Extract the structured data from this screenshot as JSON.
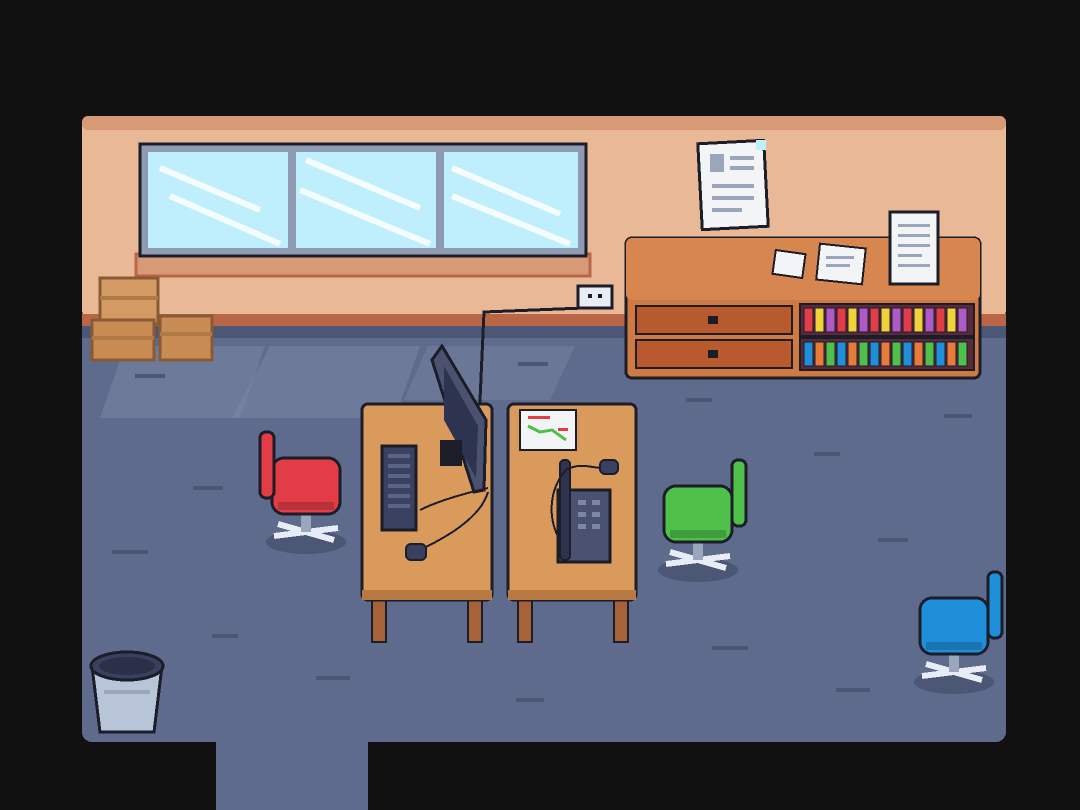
{
  "scene": {
    "type": "top-down pixel-art office room",
    "palette": {
      "background": "#111111",
      "wall": "#e9b896",
      "wall_trim": "#b86646",
      "floor": "#5f6b8c",
      "floor_dark": "#4c5675",
      "sunlight": "#7a87a5",
      "outline": "#1b1d29",
      "desk": "#d99a5c",
      "desk_leg": "#a8623a",
      "cabinet": "#cf7a43",
      "drawer": "#b95a2e",
      "window_glass": "#bfeefc",
      "window_frame": "#8f9bb3",
      "box": "#d39a64",
      "paper": "#f2f4f6",
      "chair_red": "#e23d46",
      "chair_green": "#4fc04a",
      "chair_blue": "#1e8fd8",
      "chair_base": "#e8ecf4",
      "bin": "#b8c4d8",
      "monitor": "#4a5270"
    },
    "icons": {
      "window": "window-icon",
      "notice": "notice-paper-icon",
      "cabinet": "cabinet-icon",
      "books": "book-row-icon",
      "boxes": "cardboard-box-icon",
      "outlet": "power-outlet-icon",
      "monitor": "monitor-icon",
      "keyboard": "keyboard-icon",
      "mouse": "mouse-icon",
      "phone": "desk-phone-icon",
      "chart": "chart-paper-icon",
      "chair": "office-chair-icon",
      "bin": "trash-bin-icon"
    },
    "book_colors": [
      "#e23d46",
      "#4fc04a",
      "#f2d23a",
      "#1e8fd8",
      "#b05ac8",
      "#e87a3a"
    ]
  }
}
